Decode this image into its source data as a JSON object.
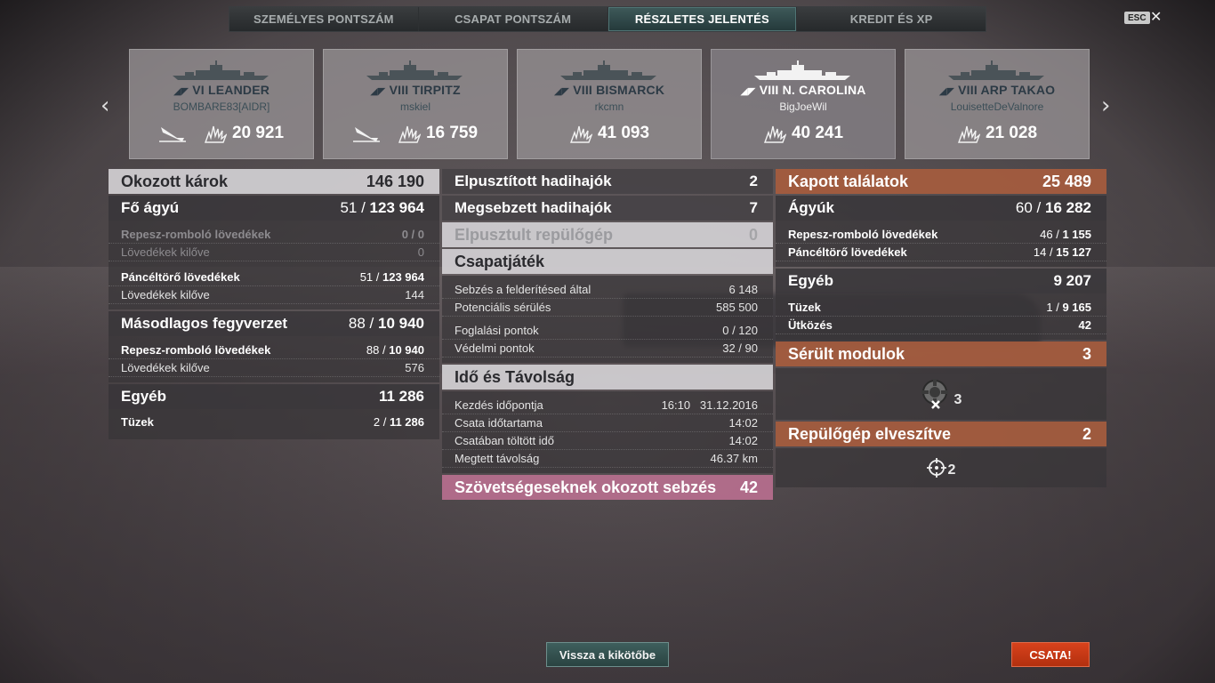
{
  "tabs": [
    "SZEMÉLYES PONTSZÁM",
    "CSAPAT PONTSZÁM",
    "RÉSZLETES JELENTÉS",
    "KREDIT ÉS XP"
  ],
  "esc_label": "ESC",
  "close_glyph": "✕",
  "ships": [
    {
      "name": "VI LEANDER",
      "player": "BOMBARE83[AIDR]",
      "damage": "20 921",
      "active": false
    },
    {
      "name": "VIII TIRPITZ",
      "player": "mskiel",
      "damage": "16 759",
      "active": false
    },
    {
      "name": "VIII BISMARCK",
      "player": "rkcmn",
      "damage": "41 093",
      "active": false
    },
    {
      "name": "VIII N. CAROLINA",
      "player": "BigJoeWil",
      "damage": "40 241",
      "active": true
    },
    {
      "name": "VIII ARP TAKAO",
      "player": "LouisetteDeValnore",
      "damage": "21 028",
      "active": false
    }
  ],
  "left": {
    "damage_caused": {
      "label": "Okozott károk",
      "value": "146 190"
    },
    "main_battery": {
      "label": "Fő ágyú",
      "hits": "51",
      "total": "123 964"
    },
    "he_shells": {
      "label": "Repesz-romboló lövedékek",
      "hits": "0",
      "total": "0"
    },
    "he_fired": {
      "label": "Lövedékek kilőve",
      "value": "0"
    },
    "ap_shells": {
      "label": "Páncéltörő lövedékek",
      "hits": "51",
      "total": "123 964"
    },
    "ap_fired": {
      "label": "Lövedékek kilőve",
      "value": "144"
    },
    "secondary": {
      "label": "Másodlagos fegyverzet",
      "hits": "88",
      "total": "10 940"
    },
    "sec_he": {
      "label": "Repesz-romboló lövedékek",
      "hits": "88",
      "total": "10 940"
    },
    "sec_fired": {
      "label": "Lövedékek kilőve",
      "value": "576"
    },
    "other": {
      "label": "Egyéb",
      "value": "11 286"
    },
    "fires": {
      "label": "Tüzek",
      "hits": "2",
      "total": "11 286"
    }
  },
  "middle": {
    "destroyed_ships": {
      "label": "Elpusztított hadihajók",
      "value": "2"
    },
    "damaged_ships": {
      "label": "Megsebzett hadihajók",
      "value": "7"
    },
    "planes_destroyed": {
      "label": "Elpusztult repülőgép",
      "value": "0"
    },
    "teamplay": {
      "label": "Csapatjáték"
    },
    "spotting_damage": {
      "label": "Sebzés a felderítésed által",
      "value": "6 148"
    },
    "potential_damage": {
      "label": "Potenciális sérülés",
      "value": "585 500"
    },
    "capture_points": {
      "label": "Foglalási pontok",
      "value": "0 / 120"
    },
    "defense_points": {
      "label": "Védelmi pontok",
      "value": "32 / 90"
    },
    "time_distance": {
      "label": "Idő és Távolság"
    },
    "start_time": {
      "label": "Kezdés időpontja",
      "value": "16:10   31.12.2016"
    },
    "battle_duration": {
      "label": "Csata időtartama",
      "value": "14:02"
    },
    "time_in_battle": {
      "label": "Csatában töltött idő",
      "value": "14:02"
    },
    "distance": {
      "label": "Megtett távolság",
      "value": "46.37 km"
    },
    "ally_damage": {
      "label": "Szövetségeseknek okozott sebzés",
      "value": "42"
    }
  },
  "right": {
    "hits_received": {
      "label": "Kapott találatok",
      "value": "25 489"
    },
    "guns": {
      "label": "Ágyúk",
      "hits": "60",
      "total": "16 282"
    },
    "he_shells": {
      "label": "Repesz-romboló lövedékek",
      "hits": "46",
      "total": "1 155"
    },
    "ap_shells": {
      "label": "Páncéltörő lövedékek",
      "hits": "14",
      "total": "15 127"
    },
    "other": {
      "label": "Egyéb",
      "value": "9 207"
    },
    "fires": {
      "label": "Tüzek",
      "hits": "1",
      "total": "9 165"
    },
    "ramming": {
      "label": "Ütközés",
      "value": "42"
    },
    "damaged_modules": {
      "label": "Sérült modulok",
      "value": "3",
      "icon_count": "3"
    },
    "planes_lost": {
      "label": "Repülőgép elveszítve",
      "value": "2",
      "icon_count": "2"
    }
  },
  "buttons": {
    "port": "Vissza a kikötőbe",
    "battle": "CSATA!"
  },
  "colors": {
    "accent_orange": "#a65c3e",
    "ally_pink": "#b46e8c",
    "battle_red": "#d8421c",
    "active_tab": "#3f5a5a"
  }
}
